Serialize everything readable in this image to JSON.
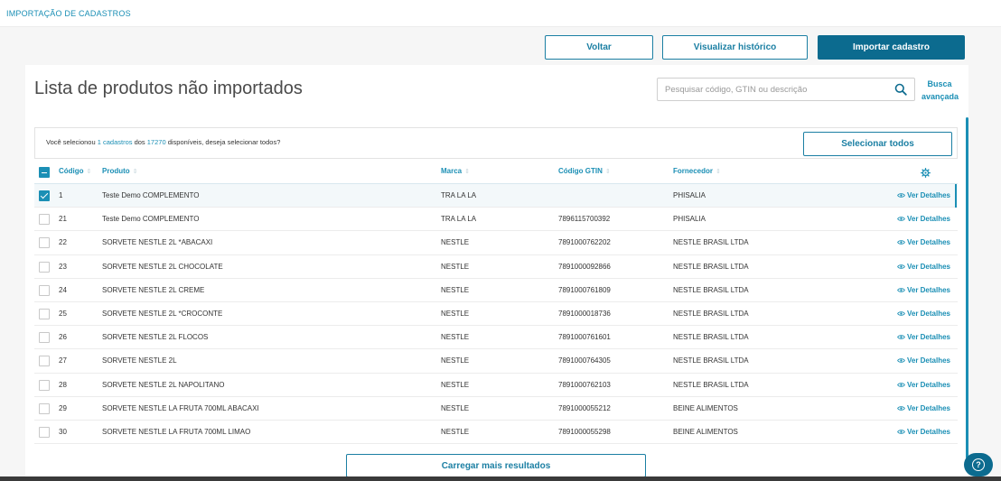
{
  "breadcrumb": "IMPORTAÇÃO DE CADASTROS",
  "actions": {
    "back": "Voltar",
    "history": "Visualizar histórico",
    "import": "Importar cadastro"
  },
  "page_title": "Lista de produtos não importados",
  "search": {
    "placeholder": "Pesquisar código, GTIN ou descrição",
    "advanced_line1": "Busca",
    "advanced_line2": "avançada"
  },
  "selection": {
    "prefix": "Você selecionou ",
    "count": "1 cadastros",
    "middle": " dos ",
    "total": "17270",
    "suffix": " disponíveis, deseja selecionar todos?",
    "select_all": "Selecionar todos"
  },
  "table": {
    "headers": {
      "code": "Código",
      "product": "Produto",
      "brand": "Marca",
      "gtin": "Código GTIN",
      "supplier": "Fornecedor"
    },
    "details_label": "Ver Detalhes",
    "rows": [
      {
        "code": "1",
        "product": "Teste Demo COMPLEMENTO",
        "brand": "TRA LA LA",
        "gtin": "",
        "supplier": "PHISALIA",
        "checked": true
      },
      {
        "code": "21",
        "product": "Teste Demo COMPLEMENTO",
        "brand": "TRA LA LA",
        "gtin": "7896115700392",
        "supplier": "PHISALIA",
        "checked": false
      },
      {
        "code": "22",
        "product": "SORVETE NESTLE 2L *ABACAXI",
        "brand": "NESTLE",
        "gtin": "7891000762202",
        "supplier": "NESTLE BRASIL LTDA",
        "checked": false
      },
      {
        "code": "23",
        "product": "SORVETE NESTLE 2L CHOCOLATE",
        "brand": "NESTLE",
        "gtin": "7891000092866",
        "supplier": "NESTLE BRASIL LTDA",
        "checked": false
      },
      {
        "code": "24",
        "product": "SORVETE NESTLE 2L CREME",
        "brand": "NESTLE",
        "gtin": "7891000761809",
        "supplier": "NESTLE BRASIL LTDA",
        "checked": false
      },
      {
        "code": "25",
        "product": "SORVETE NESTLE 2L *CROCONTE",
        "brand": "NESTLE",
        "gtin": "7891000018736",
        "supplier": "NESTLE BRASIL LTDA",
        "checked": false
      },
      {
        "code": "26",
        "product": "SORVETE NESTLE 2L FLOCOS",
        "brand": "NESTLE",
        "gtin": "7891000761601",
        "supplier": "NESTLE BRASIL LTDA",
        "checked": false
      },
      {
        "code": "27",
        "product": "SORVETE NESTLE 2L",
        "brand": "NESTLE",
        "gtin": "7891000764305",
        "supplier": "NESTLE BRASIL LTDA",
        "checked": false
      },
      {
        "code": "28",
        "product": "SORVETE NESTLE 2L NAPOLITANO",
        "brand": "NESTLE",
        "gtin": "7891000762103",
        "supplier": "NESTLE BRASIL LTDA",
        "checked": false
      },
      {
        "code": "29",
        "product": "SORVETE NESTLE LA FRUTA 700ML ABACAXI",
        "brand": "NESTLE",
        "gtin": "7891000055212",
        "supplier": "BEINE ALIMENTOS",
        "checked": false
      },
      {
        "code": "30",
        "product": "SORVETE NESTLE LA FRUTA 700ML LIMAO",
        "brand": "NESTLE",
        "gtin": "7891000055298",
        "supplier": "BEINE ALIMENTOS",
        "checked": false
      }
    ]
  },
  "load_more": "Carregar mais resultados",
  "colors": {
    "accent": "#1b8fb5",
    "primary": "#0c6b8f"
  }
}
